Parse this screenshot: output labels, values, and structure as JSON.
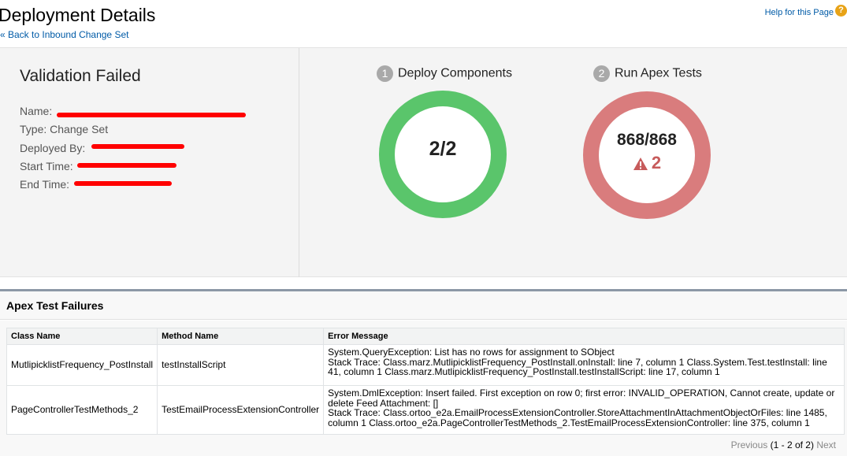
{
  "header": {
    "title": "Deployment Details",
    "back_link": "« Back to Inbound Change Set",
    "help_link": "Help for this Page",
    "help_icon": "question-icon"
  },
  "summary": {
    "status": "Validation Failed",
    "fields": {
      "name_label": "Name:",
      "type_label": "Type:",
      "type_value": "Change Set",
      "deployed_by_label": "Deployed By:",
      "start_time_label": "Start Time:",
      "end_time_label": "End Time:"
    },
    "redaction_color": "#ff0000"
  },
  "steps": [
    {
      "number": "1",
      "label": "Deploy Components",
      "value": "2/2",
      "color": "#5ac56b"
    },
    {
      "number": "2",
      "label": "Run Apex Tests",
      "value": "868/868",
      "failures": "2",
      "color": "#d97c7d",
      "failure_icon": "warning-icon"
    }
  ],
  "failures": {
    "title": "Apex Test Failures",
    "columns": [
      "Class Name",
      "Method Name",
      "Error Message"
    ],
    "rows": [
      {
        "class_name": "MutlipicklistFrequency_PostInstall",
        "method_name": "testInstallScript",
        "error_line1": "System.QueryException: List has no rows for assignment to SObject",
        "error_line2": "Stack Trace: Class.marz.MutlipicklistFrequency_PostInstall.onInstall: line 7, column 1 Class.System.Test.testInstall: line 41, column 1 Class.marz.MutlipicklistFrequency_PostInstall.testInstallScript: line 17, column 1"
      },
      {
        "class_name": "PageControllerTestMethods_2",
        "method_name": "TestEmailProcessExtensionController",
        "error_line1": "System.DmlException: Insert failed. First exception on row 0; first error: INVALID_OPERATION, Cannot create, update or delete Feed Attachment: []",
        "error_line2": "Stack Trace: Class.ortoo_e2a.EmailProcessExtensionController.StoreAttachmentInAttachmentObjectOrFiles: line 1485, column 1 Class.ortoo_e2a.PageControllerTestMethods_2.TestEmailProcessExtensionController: line 375, column 1"
      }
    ]
  },
  "pager": {
    "previous": "Previous",
    "count": "(1 - 2 of 2)",
    "next": "Next"
  }
}
